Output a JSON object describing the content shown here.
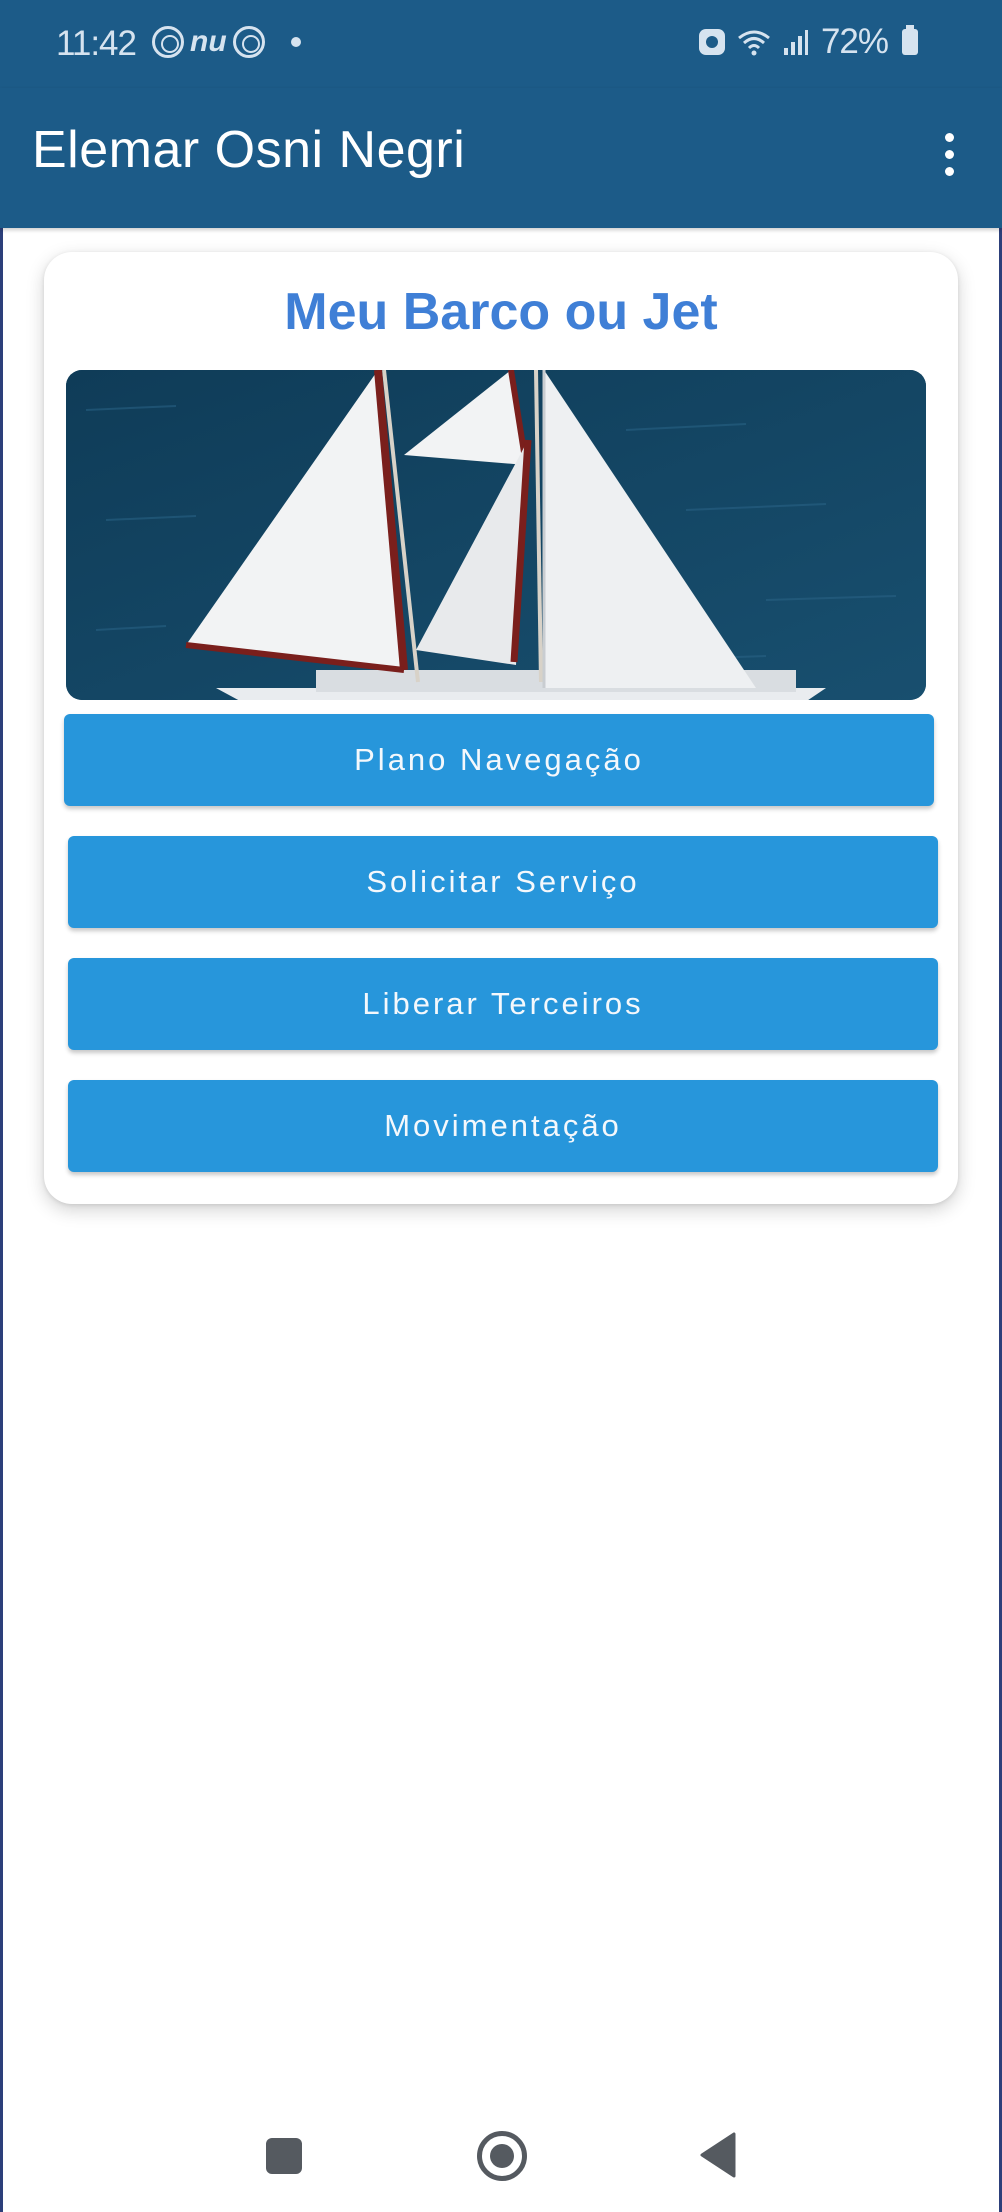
{
  "status_bar": {
    "time": "11:42",
    "left_icons": [
      "circle-app-icon",
      "nu-icon",
      "circle-app-icon",
      "dot-icon"
    ],
    "nu_text": "nu",
    "right_icons": [
      "alarm-icon",
      "wifi-icon",
      "signal-icon",
      "battery-icon"
    ],
    "battery": "72%"
  },
  "app_bar": {
    "title": "Elemar Osni Negri",
    "menu_icon": "more-vert-icon",
    "background": "#1c5b88"
  },
  "card": {
    "title": "Meu Barco ou Jet",
    "title_color": "#3f7fd6",
    "image": "sailboat-photo",
    "buttons": [
      {
        "label": "Plano Navegação"
      },
      {
        "label": "Solicitar Serviço"
      },
      {
        "label": "Liberar Terceiros"
      },
      {
        "label": "Movimentação"
      }
    ],
    "button_color": "#2796db"
  },
  "nav_bar": {
    "icons": [
      "recents-icon",
      "home-icon",
      "back-icon"
    ]
  }
}
